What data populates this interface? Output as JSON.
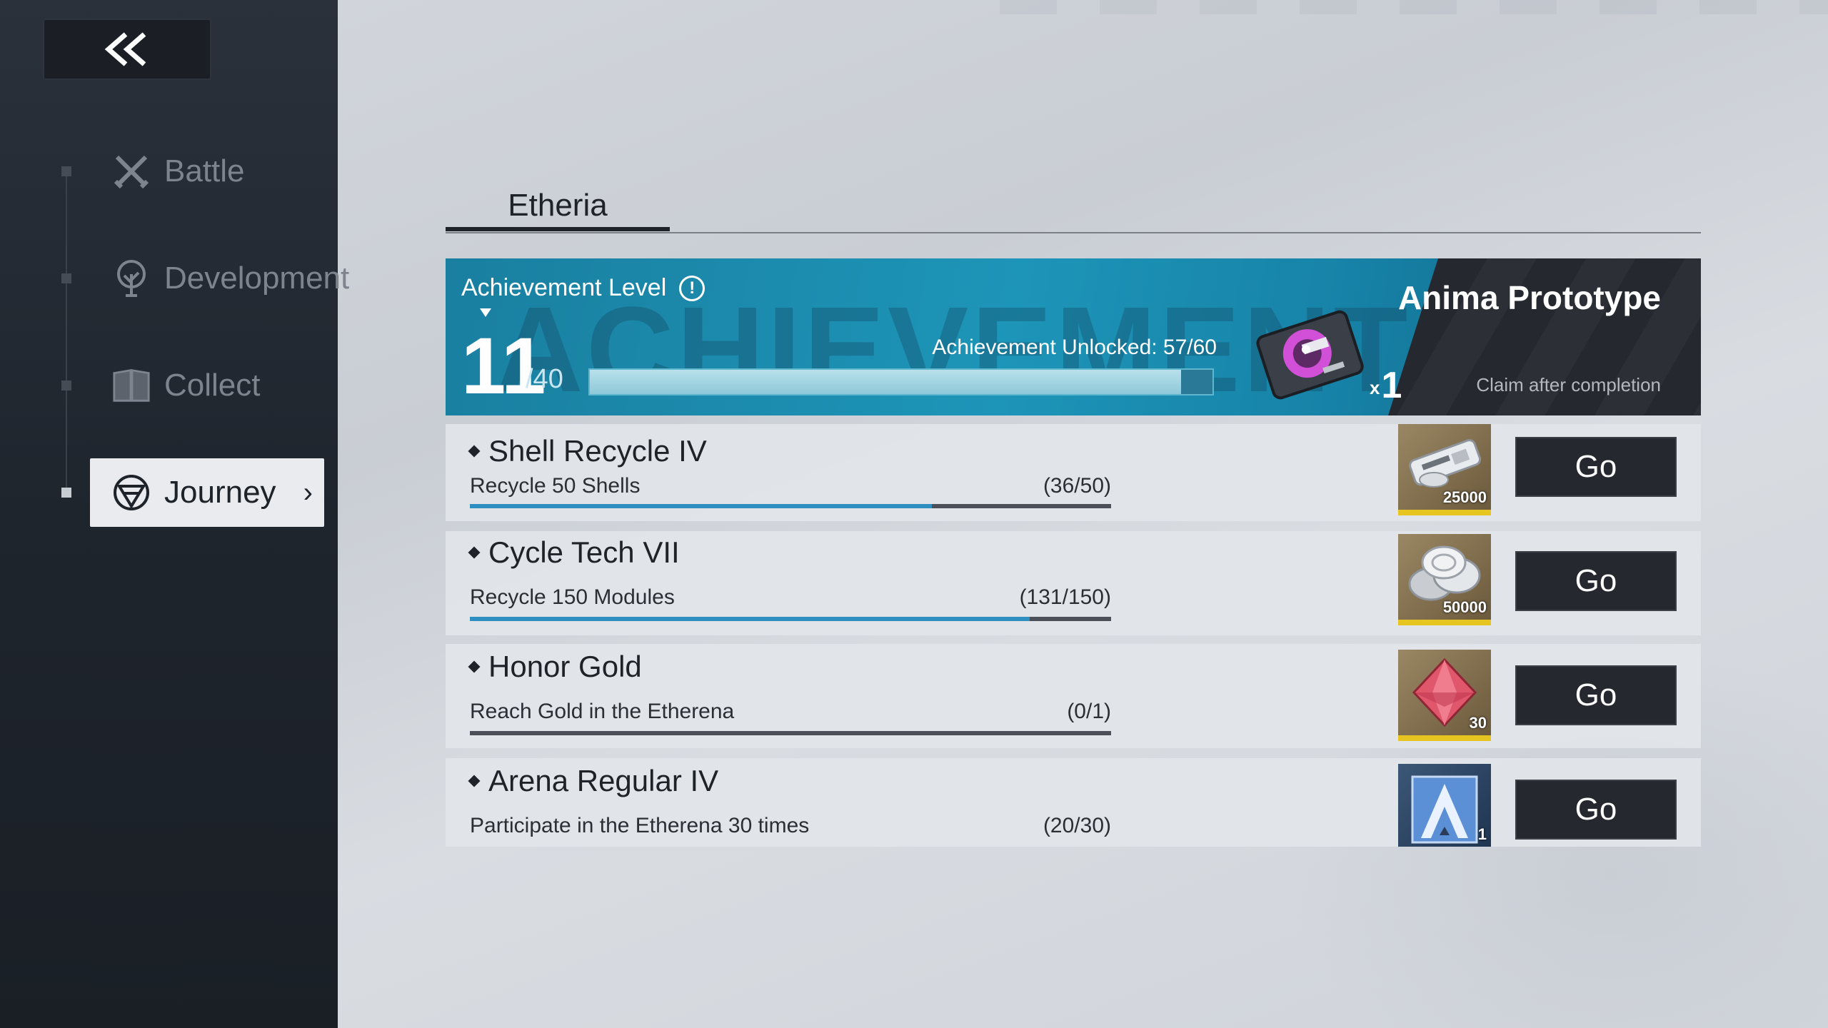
{
  "sidebar": {
    "back_label": "«",
    "items": [
      {
        "label": "Battle",
        "icon": "crossed-swords-icon"
      },
      {
        "label": "Development",
        "icon": "tree-icon"
      },
      {
        "label": "Collect",
        "icon": "book-icon"
      },
      {
        "label": "Journey",
        "icon": "journey-emblem-icon",
        "active": true
      }
    ]
  },
  "tabs": [
    {
      "label": "Etheria",
      "active": true
    }
  ],
  "banner": {
    "title": "Achievement Level",
    "level": "11",
    "level_max": "/40",
    "unlocked_text": "Achievement Unlocked: 57/60",
    "progress": 0.95,
    "reward_name": "Anima Prototype",
    "reward_count": "1",
    "reward_count_prefix": "x",
    "reward_note": "Claim after completion",
    "watermark": "ACHIEVEMENTS"
  },
  "tasks": [
    {
      "title": "Shell Recycle IV",
      "desc": "Recycle 50 Shells",
      "count": "(36/50)",
      "progress": 0.72,
      "reward_qty": "25000",
      "reward_icon": "shell-card-icon",
      "button": "Go"
    },
    {
      "title": "Cycle Tech VII",
      "desc": "Recycle 150 Modules",
      "count": "(131/150)",
      "progress": 0.873,
      "reward_qty": "50000",
      "reward_icon": "silver-coins-icon",
      "button": "Go"
    },
    {
      "title": "Honor Gold",
      "desc": "Reach Gold in the Etherena",
      "count": "(0/1)",
      "progress": 0.0,
      "reward_qty": "30",
      "reward_icon": "red-crystal-icon",
      "button": "Go"
    },
    {
      "title": "Arena Regular IV",
      "desc": "Participate in the Etherena 30 times",
      "count": "(20/30)",
      "progress": 0.667,
      "reward_qty": "1",
      "reward_icon": "arena-ticket-icon",
      "button": "Go"
    }
  ],
  "colors": {
    "accent": "#2f8fc0",
    "banner": "#1d95b8",
    "button": "#25292f",
    "reward_border": "#e6c521"
  }
}
